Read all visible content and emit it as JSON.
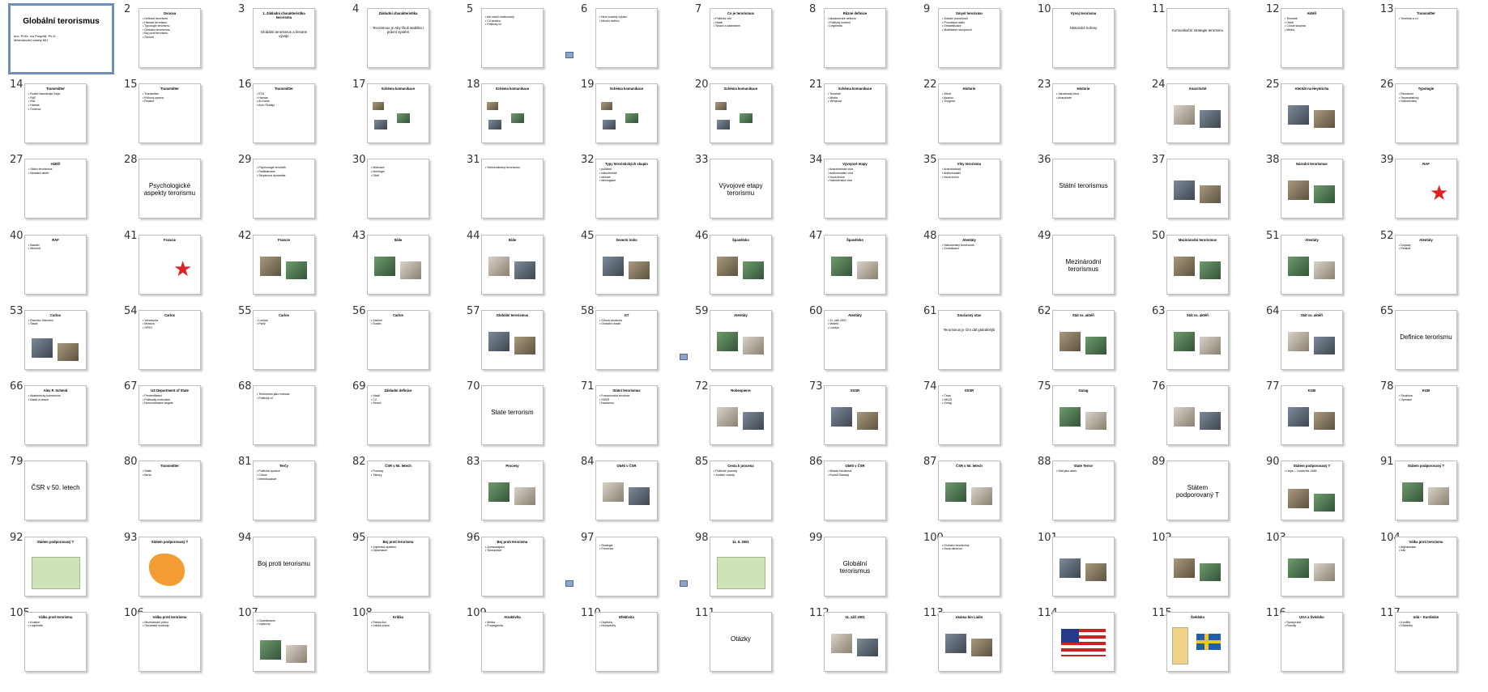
{
  "slides": [
    {
      "n": "1",
      "title": "Globální terorismus",
      "small": [
        "doc. PhDr. Ivo Pospíšil, Ph.D.",
        "Mezinárodní vztahy MU"
      ]
    },
    {
      "n": "2",
      "title": "Osnova",
      "bullets": [
        "Definice terorismu",
        "Historie terorismu",
        "Typologie terorismu",
        "Globální terorismus",
        "Boj proti terorismu",
        "Shrnutí"
      ]
    },
    {
      "n": "3",
      "title": "1. Základní charakteristika terorismu",
      "center": "Globální terorismus a historie vývoje"
    },
    {
      "n": "4",
      "title": "Základní charakteristika",
      "center": "Terorismus je Aby čkoli stabilita i právní systém"
    },
    {
      "n": "5",
      "bullets": [
        "Akt násilí motivovaný",
        "Cíl strachu",
        "Politický cíl"
      ]
    },
    {
      "n": "6",
      "bullets": [
        "Není snadný výklad",
        "Mnoho definic"
      ],
      "icon": true
    },
    {
      "n": "7",
      "title": "Co je terorismus",
      "bullets": [
        "Politické cíle",
        "Násilí",
        "Strach a zastrašení"
      ]
    },
    {
      "n": "8",
      "title": "Různé definice",
      "bullets": [
        "Akademické definice",
        "Politický kontext",
        "Legitimita"
      ]
    },
    {
      "n": "9",
      "title": "Smysl terorismu",
      "bullets": [
        "Získání pozornosti",
        "Provokace státu",
        "Destabilizace",
        "Mobilizace stoupenců"
      ]
    },
    {
      "n": "10",
      "title": "Vývoj terorismu",
      "center": "Historické kořeny"
    },
    {
      "n": "11",
      "center": "Komunikační strategie terorismu"
    },
    {
      "n": "12",
      "title": "Aktéři",
      "bullets": [
        "Teroristé",
        "Oběti",
        "Cílová skupina",
        "Média"
      ]
    },
    {
      "n": "13",
      "title": "Transmitter",
      "bullets": [
        "Terorista a cíl"
      ]
    },
    {
      "n": "14",
      "title": "Transmitter",
      "bullets": [
        "Ruské Narodnaja Volja",
        "RAF",
        "IRA",
        "Hamás",
        "Čečenci"
      ]
    },
    {
      "n": "15",
      "title": "Transmitter",
      "bullets": [
        "Transmitter",
        "Klíčová zpráva",
        "Reakce"
      ]
    },
    {
      "n": "16",
      "title": "Transmitter",
      "bullets": [
        "ETA",
        "Hamás",
        "Al-Káida",
        "Aum Šinrikjó"
      ]
    },
    {
      "n": "17",
      "title": "Schéma komunikace",
      "diagram": true
    },
    {
      "n": "18",
      "title": "Schéma komunikace",
      "diagram": true
    },
    {
      "n": "19",
      "title": "Schéma komunikace",
      "diagram": true
    },
    {
      "n": "20",
      "title": "Schéma komunikace",
      "diagram": true
    },
    {
      "n": "21",
      "title": "Schéma komunikace",
      "bullets": [
        "Teroristé",
        "Média",
        "Veřejnost"
      ]
    },
    {
      "n": "22",
      "title": "Historie",
      "bullets": [
        "Zéloti",
        "Asasíni",
        "Thugové"
      ]
    },
    {
      "n": "23",
      "title": "Historie",
      "bullets": [
        "Jakobínský teror",
        "Anarchisté"
      ]
    },
    {
      "n": "24",
      "title": "Anarchisté",
      "pics": true
    },
    {
      "n": "25",
      "title": "Atentát na Heydricha",
      "pics": true
    },
    {
      "n": "26",
      "title": "Typologie",
      "bullets": [
        "Revoluční",
        "Separatistický",
        "Náboženský"
      ]
    },
    {
      "n": "27",
      "title": "Aktéři",
      "bullets": [
        "Státní terorismus",
        "Nestátní aktéři"
      ]
    },
    {
      "n": "28",
      "big": "Psychologické aspekty terorismu"
    },
    {
      "n": "29",
      "bullets": [
        "Psychologie teroristů",
        "Radikalizace",
        "Skupinová dynamika"
      ]
    },
    {
      "n": "30",
      "bullets": [
        "Motivace",
        "Ideologie",
        "Oběť"
      ]
    },
    {
      "n": "31",
      "bullets": [
        "Sebevražedný terorismus"
      ]
    },
    {
      "n": "32",
      "title": "Typy teroristických skupin",
      "bullets": [
        "politické",
        "náboženské",
        "etnické",
        "ideologické"
      ]
    },
    {
      "n": "33",
      "big": "Vývojové etapy terorismu"
    },
    {
      "n": "34",
      "title": "Vývojové etapy",
      "bullets": [
        "Anarchistická vlna",
        "Antikoloniální vlna",
        "Nová levice",
        "Náboženská vlna"
      ]
    },
    {
      "n": "35",
      "title": "Vlny terorismu",
      "bullets": [
        "Anarchistická",
        "Antikoloniální",
        "Nová levice"
      ]
    },
    {
      "n": "36",
      "big": "Státní terorismus"
    },
    {
      "n": "37",
      "pics": true
    },
    {
      "n": "38",
      "title": "Národní terorismus",
      "pics": true
    },
    {
      "n": "39",
      "title": "RAF",
      "star": true
    },
    {
      "n": "40",
      "title": "RAF",
      "bullets": [
        "Baader",
        "Meinhof"
      ]
    },
    {
      "n": "41",
      "title": "Francie",
      "star": true
    },
    {
      "n": "42",
      "title": "Francie",
      "pics": true
    },
    {
      "n": "43",
      "title": "Itálie",
      "pics": true
    },
    {
      "n": "44",
      "title": "Itálie",
      "pics": true
    },
    {
      "n": "45",
      "title": "Severní Irsko",
      "pics": true
    },
    {
      "n": "46",
      "title": "Španělsko",
      "pics": true
    },
    {
      "n": "47",
      "title": "Španělsko",
      "pics": true
    },
    {
      "n": "48",
      "title": "Atentáty",
      "bullets": [
        "Náboženský terorismus",
        "Globalizace"
      ]
    },
    {
      "n": "49",
      "big": "Mezinárodní terorismus"
    },
    {
      "n": "50",
      "title": "Mezinárodní terorismus",
      "pics": true
    },
    {
      "n": "51",
      "title": "Atentáty",
      "pics": true
    },
    {
      "n": "52",
      "title": "Atentáty",
      "bullets": [
        "Dopady",
        "Reakce"
      ]
    },
    {
      "n": "53",
      "title": "Carlos",
      "bullets": [
        "Ramírez Sánchez",
        "Šakal"
      ],
      "pics": true
    },
    {
      "n": "54",
      "title": "Carlos",
      "bullets": [
        "Venezuela",
        "Moskva",
        "OPEC"
      ]
    },
    {
      "n": "55",
      "title": "Carlos",
      "bullets": [
        "Londýn",
        "Paříž"
      ]
    },
    {
      "n": "56",
      "title": "Carlos",
      "bullets": [
        "Zatčení",
        "Súdán"
      ]
    },
    {
      "n": "57",
      "title": "Globální terorismus",
      "pics": true
    },
    {
      "n": "58",
      "title": "GT",
      "bullets": [
        "Síťová struktura",
        "Globální dosah"
      ]
    },
    {
      "n": "59",
      "title": "Atentáty",
      "pics": true,
      "icon": true
    },
    {
      "n": "60",
      "title": "Atentáty",
      "bullets": [
        "11. září 2001",
        "Madrid",
        "Londýn"
      ]
    },
    {
      "n": "61",
      "title": "Současný stav",
      "center": "Terorismus je čím dál globálnější"
    },
    {
      "n": "62",
      "title": "Stát vs. aktéři",
      "pics": true
    },
    {
      "n": "63",
      "title": "Stát vs. aktéři",
      "pics": true
    },
    {
      "n": "64",
      "title": "Stát vs. aktéři",
      "pics": true
    },
    {
      "n": "65",
      "big": "Definice terorismu"
    },
    {
      "n": "66",
      "title": "Alex P. Schmid",
      "bullets": [
        "Akademický konsenzus",
        "Násilí a strach"
      ]
    },
    {
      "n": "67",
      "title": "US Department of State",
      "bullets": [
        "Premeditated",
        "Politically motivated",
        "Noncombatant targets"
      ]
    },
    {
      "n": "68",
      "bullets": [
        "Terorismus jako metoda",
        "Politický cíl"
      ]
    },
    {
      "n": "69",
      "title": "Základní definice",
      "bullets": [
        "Násilí",
        "Cíl",
        "Strach"
      ]
    },
    {
      "n": "70",
      "big": "State terrorism"
    },
    {
      "n": "71",
      "title": "Státní terorismus",
      "bullets": [
        "Francouzská revoluce",
        "SSSR",
        "Nacismus"
      ]
    },
    {
      "n": "72",
      "title": "Robespierre",
      "pics": true
    },
    {
      "n": "73",
      "title": "SSSR",
      "pics": true
    },
    {
      "n": "74",
      "title": "SSSR",
      "bullets": [
        "Čeka",
        "NKVD",
        "Gulag"
      ]
    },
    {
      "n": "75",
      "title": "Gulag",
      "pics": true
    },
    {
      "n": "76",
      "pics": true
    },
    {
      "n": "77",
      "title": "KGB",
      "pics": true
    },
    {
      "n": "78",
      "title": "KGB",
      "bullets": [
        "Struktura",
        "Operace"
      ]
    },
    {
      "n": "79",
      "big": "ČSR v 50. letech"
    },
    {
      "n": "80",
      "title": "Transmitter",
      "bullets": [
        "Stalin",
        "Beria"
      ]
    },
    {
      "n": "81",
      "title": "Terčy",
      "bullets": [
        "Politická opozice",
        "Církve",
        "Intelektuálové"
      ]
    },
    {
      "n": "82",
      "title": "ČSR v 50. letech",
      "bullets": [
        "Procesy",
        "Tábory"
      ]
    },
    {
      "n": "83",
      "title": "Procesy",
      "pics": true
    },
    {
      "n": "84",
      "title": "Oběti v ČSR",
      "pics": true
    },
    {
      "n": "85",
      "title": "Cesta k procesu",
      "bullets": [
        "Politické procesy",
        "Justiční vraždy"
      ]
    },
    {
      "n": "86",
      "title": "Oběti v ČSR",
      "bullets": [
        "Milada Horáková",
        "Rudolf Slánský"
      ]
    },
    {
      "n": "87",
      "title": "ČSR v 50. letech",
      "pics": true
    },
    {
      "n": "88",
      "title": "State Terror",
      "bullets": [
        "Stát jako aktér"
      ]
    },
    {
      "n": "89",
      "big": "Státem podporovaný T"
    },
    {
      "n": "90",
      "title": "Státem podporovaný T",
      "bullets": [
        "Libye – Lockerbie 1988"
      ],
      "pics": true
    },
    {
      "n": "91",
      "title": "Státem podporovaný T",
      "pics": true
    },
    {
      "n": "92",
      "title": "Státem podporovaný T",
      "map": true
    },
    {
      "n": "93",
      "title": "Státem podporovaný T",
      "orangemap": true
    },
    {
      "n": "94",
      "big": "Boj proti terorismu"
    },
    {
      "n": "95",
      "title": "Boj proti terorismu",
      "bullets": [
        "Vojenská opatření",
        "Diplomacie"
      ]
    },
    {
      "n": "96",
      "title": "Boj proti terorismu",
      "bullets": [
        "Zpravodajství",
        "Spolupráce"
      ]
    },
    {
      "n": "97",
      "bullets": [
        "Strategie",
        "Prevence"
      ],
      "icon": true
    },
    {
      "n": "98",
      "title": "11. 9. 2001",
      "map": true,
      "icon": true
    },
    {
      "n": "99",
      "big": "Globální terorismus"
    },
    {
      "n": "100",
      "bullets": [
        "Globální terorismus",
        "Nová dimenze"
      ]
    },
    {
      "n": "101",
      "pics": true
    },
    {
      "n": "102",
      "pics": true
    },
    {
      "n": "103",
      "pics": true
    },
    {
      "n": "104",
      "title": "Válka proti terorismu",
      "bullets": [
        "Afghánistán",
        "Irák"
      ]
    },
    {
      "n": "105",
      "title": "Válka proti terorismu",
      "bullets": [
        "Koalice",
        "Legitimita"
      ]
    },
    {
      "n": "106",
      "title": "Válka proti terorismu",
      "bullets": [
        "Mezinárodní právo",
        "Občanské svobody"
      ]
    },
    {
      "n": "107",
      "bullets": [
        "Guantánamo",
        "Výslechy"
      ],
      "pics": true
    },
    {
      "n": "108",
      "title": "Kritika",
      "bullets": [
        "Patriot Act",
        "Lidská práva"
      ]
    },
    {
      "n": "109",
      "title": "Atraktivita",
      "bullets": [
        "Média",
        "Propaganda"
      ]
    },
    {
      "n": "110",
      "title": "Efektivita",
      "bullets": [
        "Úspěchy",
        "Neúspěchy"
      ]
    },
    {
      "n": "111",
      "big": "Otázky"
    },
    {
      "n": "112",
      "title": "11. září 2001",
      "pics": true
    },
    {
      "n": "113",
      "title": "Usáma bin Ládin",
      "pics": true
    },
    {
      "n": "114",
      "flagUS": true
    },
    {
      "n": "115",
      "title": "Švédsko",
      "flagSE": true
    },
    {
      "n": "116",
      "title": "USA a Švédsko",
      "bullets": [
        "Spolupráce",
        "Rozdíly"
      ]
    },
    {
      "n": "117",
      "title": "Irák – Kurdistán",
      "bullets": [
        "Konflikt",
        "Důsledky"
      ]
    }
  ],
  "selected": "1"
}
